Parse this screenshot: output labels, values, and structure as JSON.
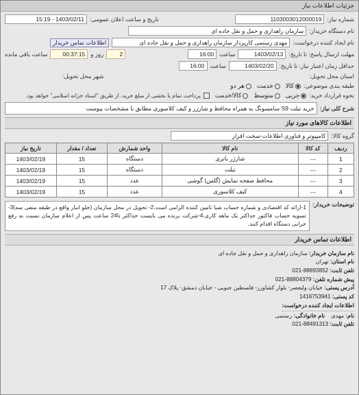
{
  "window": {
    "title": "جزئیات اطلاعات نیاز"
  },
  "header": {
    "need_number_label": "شماره نیاز:",
    "need_number": "1103003012000019",
    "announce_label": "تاریخ و ساعت اعلان عمومی:",
    "announce_value": "1403/02/11 - 15:19",
    "buyer_org_label": "نام دستگاه خریدار:",
    "buyer_org": "سازمان راهداری و حمل و نقل جاده ای",
    "requester_label": "نام ایجاد کننده درخواست:",
    "requester": "مهدی رستمی کارپرداز سازمان راهداری و حمل و نقل جاده ای",
    "contact_btn": "اطلاعات تماس خریدار",
    "deadline_send_label": "مهلت ارسال پاسخ: تا تاریخ:",
    "deadline_date": "1403/02/13",
    "time_label": "ساعت",
    "deadline_time": "16:00",
    "remain_label": "روز و",
    "remain_days": "2",
    "remain_time": "00:37:15",
    "remain_suffix": "ساعت باقی مانده",
    "validity_label": "حداقل زمان اعتبار نیاز: تا تاریخ:",
    "validity_date": "1403/02/20",
    "validity_time": "16:00",
    "deliver_province_label": "استان محل تحویل:",
    "deliver_city_label": "شهر محل تحویل:",
    "packaging_label": "طبقه بندی موضوعی:",
    "pkg_opt1": "کالا",
    "pkg_opt2": "خدمت",
    "pkg_opt3": "هر دو",
    "purchase_type_label": "نحوه قرارداد خرید:",
    "pt_low": "جزیی",
    "pt_mid": "متوسط",
    "pt_high": "کالا/خدمت",
    "pay_note": "پرداخت تمام یا بخشی از مبلغ خرید، از طریق \"اسناد خزانه اسلامی\" خواهد بود.",
    "desc_label": "شرح کلی نیاز:",
    "desc": "خرید تبلت S9 سامسونگ به همراه محافظ و شارژر و کیف کلاسوری مطابق با مشخصات پیوست"
  },
  "section_titles": {
    "goods_info": "اطلاعات کالاهای مورد نیاز",
    "contact_info": "اطلاعات تماس خریدار"
  },
  "group": {
    "label": "گروه کالا:",
    "value": "کامپیوتر و فناوری اطلاعات-سخت افزار"
  },
  "table": {
    "headers": [
      "ردیف",
      "کد کالا",
      "نام کالا",
      "واحد شمارش",
      "تعداد / مقدار",
      "تاریخ نیاز"
    ],
    "rows": [
      [
        "1",
        "---",
        "شارژر باتری",
        "دستگاه",
        "15",
        "1403/02/19"
      ],
      [
        "2",
        "---",
        "تبلت",
        "دستگاه",
        "15",
        "1403/02/19"
      ],
      [
        "3",
        "---",
        "محافظ صفحه نمایش (گلس) گوشی",
        "عدد",
        "15",
        "1403/02/19"
      ],
      [
        "4",
        "---",
        "کیف کلاسوری",
        "عدد",
        "15",
        "1403/02/19"
      ]
    ]
  },
  "notes": {
    "label": "توضیحات خریدار:",
    "text": "1-ارائه کد اقتصادی و شماره حساب شبا تامین کننده الزامی است.2- تحویل در محل سازمان (جلو انبار واقع در طبقه منفی سه)3-تسویه حساب فاکتور حداکثر یک ماهه کاری.4-شرکت برنده می بایست حداکثر تا24 ساعت پس از اعلام سازمان نسبت به رفع خرابی دستگاه اقدام کنند."
  },
  "contact": {
    "org_label": "نام سازمان خریدار:",
    "org": "سازمان راهداری و حمل و نقل جاده ای",
    "province_label": "نام استان:",
    "province": "تهران",
    "phone_label": "تلفن ثابت:",
    "phone": "88893852-021",
    "fax_label": "پیش شماره تلفن:",
    "fax": "88804379-021",
    "address_label": "آدرس پستی:",
    "address": "خیابان ولیعصر- بلوار کشاورز- فلسطین جنوبی - خیابان دمشق- پلاک 17",
    "postcode_label": "کد پستی:",
    "postcode": "1416753941",
    "requester_section": "اطلاعات ایجاد کننده درخواست:",
    "name_label": "نام:",
    "name": "مهدی",
    "family_type_label": "نام خانوادگی:",
    "family_type": "رستمی",
    "req_phone_label": "تلفن ثابت:",
    "req_phone": "88491313-021"
  }
}
